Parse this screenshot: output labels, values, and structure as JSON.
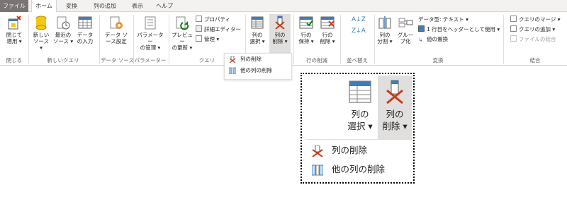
{
  "tabs": [
    "ファイル",
    "ホーム",
    "変換",
    "列の追加",
    "表示",
    "ヘルプ"
  ],
  "groups": {
    "close": {
      "label": "閉じる",
      "btn": "閉じて\n適用 ▾"
    },
    "newquery": {
      "label": "新しいクエリ",
      "btns": [
        "新しい\nソース ▾",
        "最近の\nソース ▾",
        "データ\nの入力"
      ]
    },
    "datasource": {
      "label": "データ ソース",
      "btn": "データ ソ\nース設定"
    },
    "params": {
      "label": "パラメーター",
      "btn": "パラメーター\nの管理 ▾"
    },
    "query": {
      "label": "クエリ",
      "btn": "プレビュー\nの更新 ▾",
      "small": [
        "プロパティ",
        "詳細エディター",
        "管理 ▾"
      ]
    },
    "manage_cols": {
      "btns": [
        "列の\n選択 ▾",
        "列の\n削除 ▾"
      ]
    },
    "reduce_rows": {
      "label": "行の削減",
      "btns": [
        "行の\n保持 ▾",
        "行の\n削除 ▾"
      ]
    },
    "sort": {
      "label": "並べ替え"
    },
    "transform": {
      "label": "変換",
      "btns": [
        "列の\n分割 ▾",
        "グルー\nプ化"
      ],
      "small": [
        "データ型: テキスト ▾",
        "1 行目をヘッダーとして使用 ▾",
        "値の置換"
      ]
    },
    "combine": {
      "label": "結合",
      "small": [
        "クエリのマージ ▾",
        "クエリの追加 ▾",
        "ファイルの結合"
      ]
    }
  },
  "dropdown": {
    "items": [
      "列の削除",
      "他の列の削除"
    ]
  },
  "zoom": {
    "btns": [
      "列の\n選択 ▾",
      "列の\n削除 ▾"
    ],
    "items": [
      "列の削除",
      "他の列の削除"
    ]
  }
}
